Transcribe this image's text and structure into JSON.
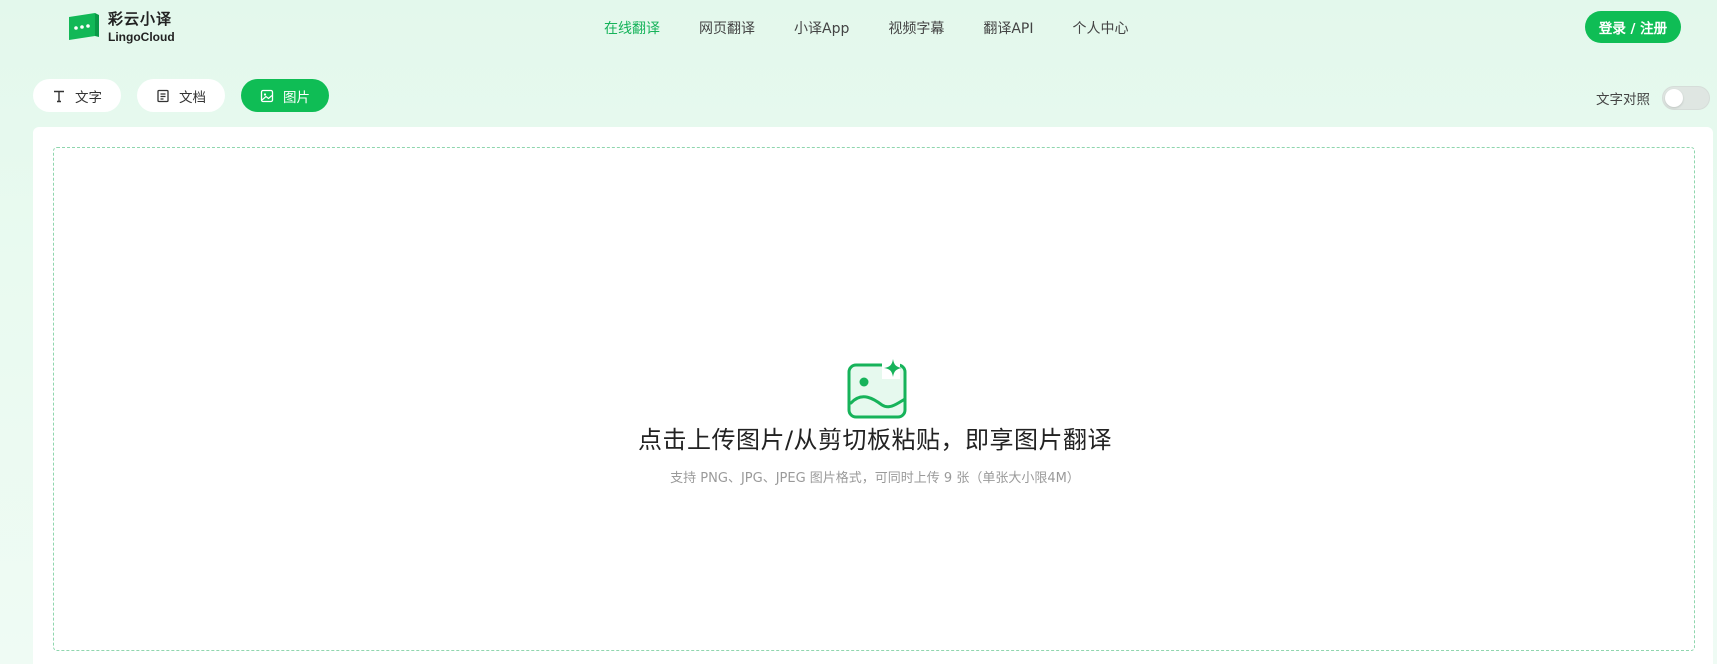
{
  "logo": {
    "name_cn": "彩云小译",
    "name_en": "LingoCloud"
  },
  "nav": [
    {
      "label": "在线翻译",
      "active": true
    },
    {
      "label": "网页翻译",
      "active": false
    },
    {
      "label": "小译App",
      "active": false
    },
    {
      "label": "视频字幕",
      "active": false
    },
    {
      "label": "翻译API",
      "active": false
    },
    {
      "label": "个人中心",
      "active": false
    }
  ],
  "auth": {
    "login_label": "登录 / 注册"
  },
  "tabs": [
    {
      "label": "文字",
      "icon": "text-icon",
      "active": false
    },
    {
      "label": "文档",
      "icon": "document-icon",
      "active": false
    },
    {
      "label": "图片",
      "icon": "image-icon",
      "active": true
    }
  ],
  "compare": {
    "label": "文字对照",
    "enabled": false
  },
  "upload": {
    "icon": "image-upload-icon",
    "title": "点击上传图片/从剪切板粘贴，即享图片翻译",
    "subtitle": "支持 PNG、JPG、JPEG 图片格式，可同时上传 9 张（单张大小限4M）"
  },
  "colors": {
    "accent": "#0fbd55",
    "nav_active": "#16b35a",
    "background": "#e6f9ee"
  }
}
